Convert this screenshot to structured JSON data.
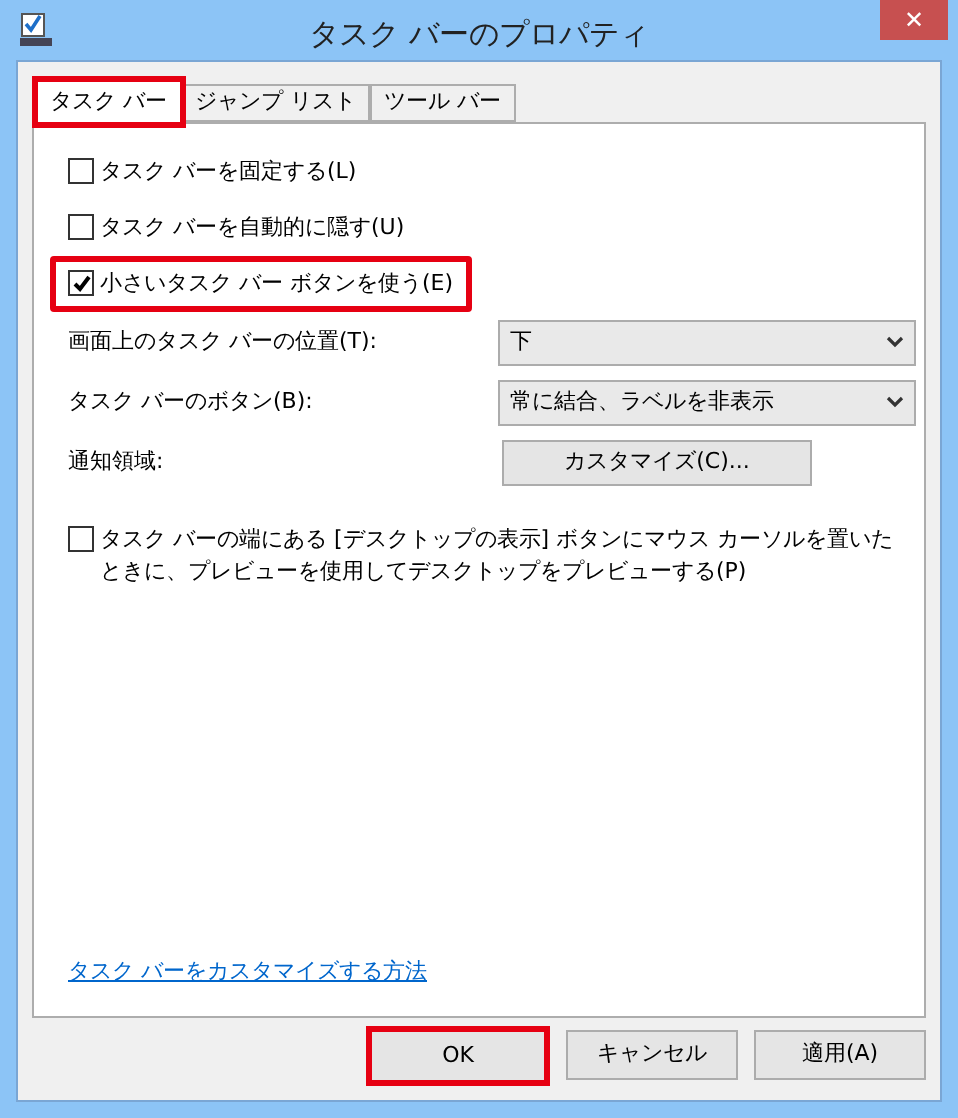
{
  "window": {
    "title": "タスク バーのプロパティ",
    "close": "✕"
  },
  "tabs": [
    {
      "label": "タスク バー",
      "selected": true,
      "highlighted": true
    },
    {
      "label": "ジャンプ リスト",
      "selected": false,
      "highlighted": false
    },
    {
      "label": "ツール バー",
      "selected": false,
      "highlighted": false
    }
  ],
  "options": [
    {
      "kind": "checkbox",
      "label": "タスク バーを固定する(L)",
      "checked": false,
      "highlighted": false
    },
    {
      "kind": "checkbox",
      "label": "タスク バーを自動的に隠す(U)",
      "checked": false,
      "highlighted": false
    },
    {
      "kind": "checkbox",
      "label": "小さいタスク バー ボタンを使う(E)",
      "checked": true,
      "highlighted": true
    },
    {
      "kind": "select",
      "label": "画面上のタスク バーの位置(T):",
      "value": "下"
    },
    {
      "kind": "select",
      "label": "タスク バーのボタン(B):",
      "value": "常に結合、ラベルを非表示"
    },
    {
      "kind": "button",
      "label": "通知領域:",
      "value": "カスタマイズ(C)..."
    },
    {
      "kind": "checkbox",
      "label": "タスク バーの端にある [デスクトップの表示] ボタンにマウス カーソルを置いたときに、プレビューを使用してデスクトップをプレビューする(P)",
      "checked": false,
      "highlighted": false
    }
  ],
  "link": "タスク バーをカスタマイズする方法",
  "buttons": [
    {
      "label": "OK",
      "highlighted": true
    },
    {
      "label": "キャンセル",
      "highlighted": false
    },
    {
      "label": "適用(A)",
      "highlighted": false
    }
  ]
}
